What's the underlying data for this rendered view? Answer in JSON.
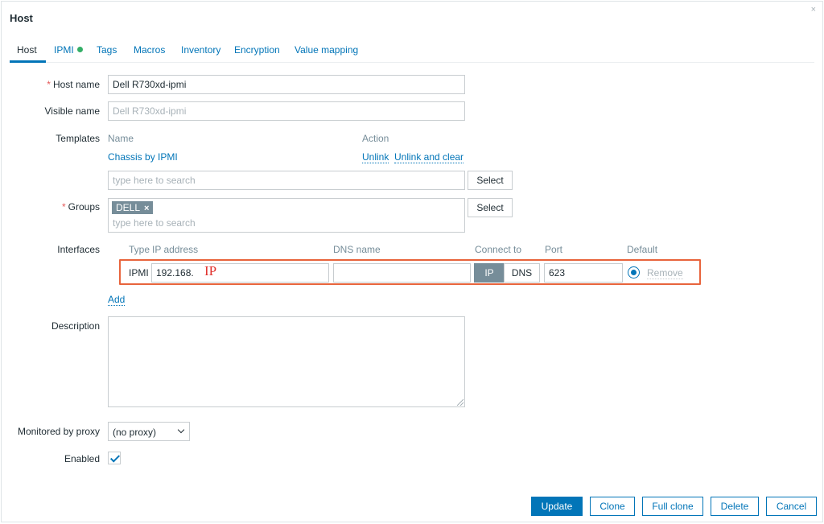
{
  "dialog": {
    "title": "Host",
    "close": "×"
  },
  "tabs": [
    {
      "label": "Host"
    },
    {
      "label": "IPMI"
    },
    {
      "label": "Tags"
    },
    {
      "label": "Macros"
    },
    {
      "label": "Inventory"
    },
    {
      "label": "Encryption"
    },
    {
      "label": "Value mapping"
    }
  ],
  "form": {
    "required_mark": "*",
    "host_name": {
      "label": "Host name",
      "value": "Dell R730xd-ipmi"
    },
    "visible_name": {
      "label": "Visible name",
      "placeholder": "Dell R730xd-ipmi"
    },
    "templates": {
      "label": "Templates",
      "col_name": "Name",
      "col_action": "Action",
      "linked": "Chassis by IPMI",
      "unlink": "Unlink",
      "unlink_clear": "Unlink and clear",
      "search_placeholder": "type here to search",
      "select": "Select"
    },
    "groups": {
      "label": "Groups",
      "tag": "DELL",
      "tag_remove": "×",
      "search_placeholder": "type here to search",
      "select": "Select"
    },
    "interfaces": {
      "label": "Interfaces",
      "col_type": "Type",
      "col_ip": "IP address",
      "col_dns": "DNS name",
      "col_connect": "Connect to",
      "col_port": "Port",
      "col_default": "Default",
      "row": {
        "type": "IPMI",
        "ip": "192.168.",
        "ip_annotation": "IP",
        "dns": "",
        "connect_ip": "IP",
        "connect_dns": "DNS",
        "port": "623",
        "remove": "Remove"
      },
      "add": "Add"
    },
    "description": {
      "label": "Description",
      "value": ""
    },
    "proxy": {
      "label": "Monitored by proxy",
      "value": "(no proxy)"
    },
    "enabled": {
      "label": "Enabled",
      "checked": true
    }
  },
  "footer": {
    "update": "Update",
    "clone": "Clone",
    "full_clone": "Full clone",
    "delete": "Delete",
    "cancel": "Cancel"
  },
  "colors": {
    "accent": "#0275b8",
    "required": "#e45959",
    "highlight_box": "#e8643c",
    "status_dot": "#34af67"
  }
}
